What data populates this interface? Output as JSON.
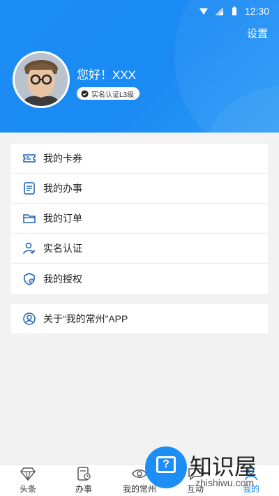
{
  "statusbar": {
    "time": "12:30"
  },
  "header": {
    "settings_label": "设置",
    "greeting": "您好！XXX",
    "verify_badge": "实名认证L3级"
  },
  "menu": {
    "items": [
      {
        "label": "我的卡券",
        "icon": "ticket-icon"
      },
      {
        "label": "我的办事",
        "icon": "document-icon"
      },
      {
        "label": "我的订单",
        "icon": "folder-icon"
      },
      {
        "label": "实名认证",
        "icon": "user-check-icon"
      },
      {
        "label": "我的授权",
        "icon": "shield-icon"
      }
    ]
  },
  "about": {
    "label": "关于“我的常州”APP",
    "icon": "user-circle-icon"
  },
  "tabbar": {
    "items": [
      {
        "label": "头条",
        "icon": "diamond-icon"
      },
      {
        "label": "办事",
        "icon": "clipboard-clock-icon"
      },
      {
        "label": "我的常州",
        "icon": "eye-icon"
      },
      {
        "label": "互动",
        "icon": "chat-icon"
      },
      {
        "label": "我的",
        "icon": "person-icon"
      }
    ],
    "active": "我的"
  },
  "watermark": {
    "brand_text": "知识屋",
    "site": "zhishiwu.com"
  },
  "colors": {
    "primary": "#1a8af4",
    "background": "#f2f2f2"
  }
}
